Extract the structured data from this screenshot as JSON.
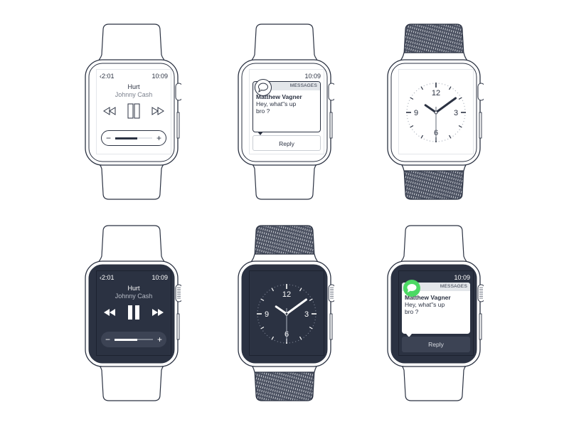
{
  "colors": {
    "outline": "#2b3242",
    "dark_screen": "#2b3242",
    "light_gray": "#e3e6ea",
    "messages_green": "#4cd964",
    "secondary_text": "#7b818d"
  },
  "watches": [
    {
      "id": "music-light",
      "theme": "light",
      "band": "sport",
      "screen": "music",
      "status": {
        "left": "‹2:01",
        "right": "10:09"
      },
      "song": {
        "title": "Hurt",
        "artist": "Johnny Cash"
      },
      "controls": {
        "rewind_icon": "rewind-icon",
        "pause_icon": "pause-icon",
        "forward_icon": "fast-forward-icon"
      },
      "volume": {
        "minus": "−",
        "plus": "+",
        "level": 0.6
      }
    },
    {
      "id": "message-light",
      "theme": "light",
      "band": "sport",
      "screen": "message",
      "status": {
        "right": "10:09"
      },
      "notification": {
        "app": "MESSAGES",
        "sender": "Matthew Vagner",
        "line1": "Hey, what\"s up",
        "line2": "bro ?"
      },
      "reply_label": "Reply"
    },
    {
      "id": "clock-light",
      "theme": "light",
      "band": "milanese",
      "screen": "clock",
      "clock": {
        "numbers": [
          "12",
          "3",
          "6",
          "9"
        ],
        "time": "10:09"
      }
    },
    {
      "id": "music-dark",
      "theme": "dark",
      "band": "sport",
      "screen": "music",
      "status": {
        "left": "‹2:01",
        "right": "10:09"
      },
      "song": {
        "title": "Hurt",
        "artist": "Johnny Cash"
      },
      "controls": {
        "rewind_icon": "rewind-icon",
        "pause_icon": "pause-icon",
        "forward_icon": "fast-forward-icon"
      },
      "volume": {
        "minus": "−",
        "plus": "+",
        "level": 0.6
      }
    },
    {
      "id": "clock-dark",
      "theme": "dark",
      "band": "milanese",
      "screen": "clock",
      "clock": {
        "numbers": [
          "12",
          "3",
          "6",
          "9"
        ],
        "time": "10:09"
      }
    },
    {
      "id": "message-dark",
      "theme": "dark",
      "band": "sport",
      "screen": "message",
      "status": {
        "right": "10:09"
      },
      "notification": {
        "app": "MESSAGES",
        "sender": "Matthew Vagner",
        "line1": "Hey, what\"s up",
        "line2": "bro ?"
      },
      "reply_label": "Reply"
    }
  ]
}
